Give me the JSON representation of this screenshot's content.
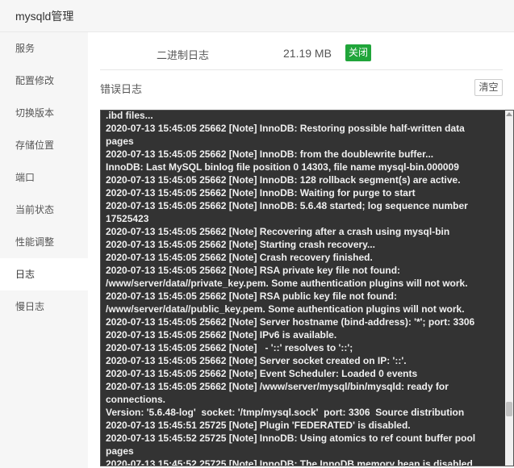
{
  "window": {
    "title": "mysqld管理"
  },
  "sidebar": {
    "items": [
      {
        "label": "服务"
      },
      {
        "label": "配置修改"
      },
      {
        "label": "切换版本"
      },
      {
        "label": "存储位置"
      },
      {
        "label": "端口"
      },
      {
        "label": "当前状态"
      },
      {
        "label": "性能调整"
      },
      {
        "label": "日志",
        "active": true
      },
      {
        "label": "慢日志"
      }
    ]
  },
  "binlog": {
    "label": "二进制日志",
    "size": "21.19 MB",
    "toggle_label": "关闭",
    "toggle_color": "#20a53a"
  },
  "error_log": {
    "label": "错误日志",
    "clear_label": "清空",
    "content": ".ibd files...\n2020-07-13 15:45:05 25662 [Note] InnoDB: Restoring possible half-written data pages\n2020-07-13 15:45:05 25662 [Note] InnoDB: from the doublewrite buffer...\nInnoDB: Last MySQL binlog file position 0 14303, file name mysql-bin.000009\n2020-07-13 15:45:05 25662 [Note] InnoDB: 128 rollback segment(s) are active.\n2020-07-13 15:45:05 25662 [Note] InnoDB: Waiting for purge to start\n2020-07-13 15:45:05 25662 [Note] InnoDB: 5.6.48 started; log sequence number 17525423\n2020-07-13 15:45:05 25662 [Note] Recovering after a crash using mysql-bin\n2020-07-13 15:45:05 25662 [Note] Starting crash recovery...\n2020-07-13 15:45:05 25662 [Note] Crash recovery finished.\n2020-07-13 15:45:05 25662 [Note] RSA private key file not found: /www/server/data//private_key.pem. Some authentication plugins will not work.\n2020-07-13 15:45:05 25662 [Note] RSA public key file not found: /www/server/data//public_key.pem. Some authentication plugins will not work.\n2020-07-13 15:45:05 25662 [Note] Server hostname (bind-address): '*'; port: 3306\n2020-07-13 15:45:05 25662 [Note] IPv6 is available.\n2020-07-13 15:45:05 25662 [Note]   - '::' resolves to '::';\n2020-07-13 15:45:05 25662 [Note] Server socket created on IP: '::'.\n2020-07-13 15:45:05 25662 [Note] Event Scheduler: Loaded 0 events\n2020-07-13 15:45:05 25662 [Note] /www/server/mysql/bin/mysqld: ready for connections.\nVersion: '5.6.48-log'  socket: '/tmp/mysql.sock'  port: 3306  Source distribution\n2020-07-13 15:45:51 25725 [Note] Plugin 'FEDERATED' is disabled.\n2020-07-13 15:45:52 25725 [Note] InnoDB: Using atomics to ref count buffer pool pages\n2020-07-13 15:45:52 25725 [Note] InnoDB: The InnoDB memory heap is disabled"
  }
}
